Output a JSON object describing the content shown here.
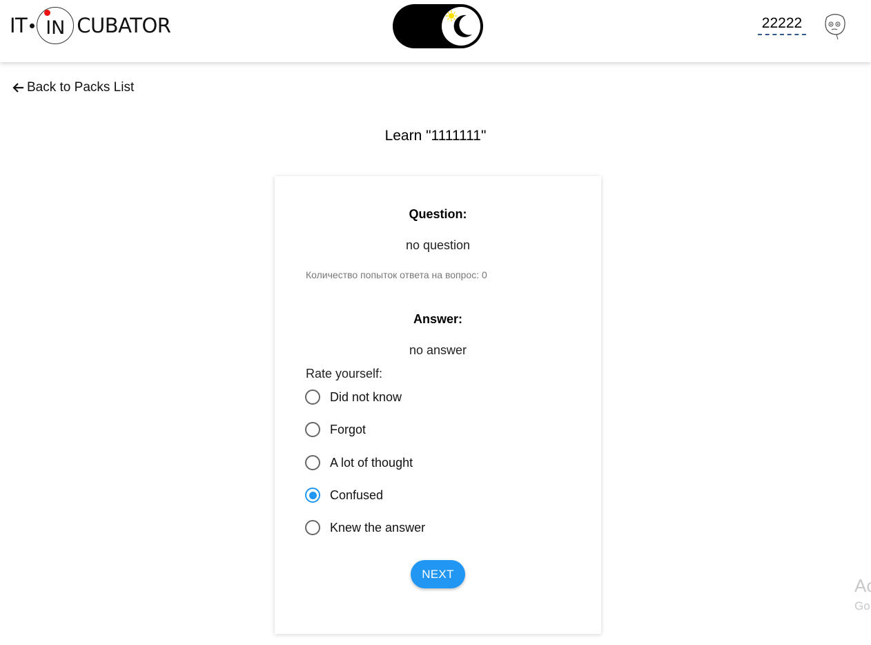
{
  "header": {
    "logo": {
      "left": "IT",
      "middle": "IN",
      "right": "CUBATOR"
    },
    "theme_toggle": {
      "state": "dark",
      "icon": "moon-sun-icon"
    },
    "user": {
      "name": "22222",
      "avatar_icon": "meme-face-avatar-icon"
    }
  },
  "nav": {
    "back_label": "Back to Packs List",
    "back_icon": "arrow-left-icon"
  },
  "page": {
    "title": "Learn \"1111111\""
  },
  "card": {
    "question_label": "Question:",
    "question_text": "no question",
    "attempts_text": "Количество попыток ответа на вопрос: 0",
    "answer_label": "Answer:",
    "answer_text": "no answer",
    "rate_label": "Rate yourself:",
    "options": [
      {
        "label": "Did not know",
        "selected": false
      },
      {
        "label": "Forgot",
        "selected": false
      },
      {
        "label": "A lot of thought",
        "selected": false
      },
      {
        "label": "Confused",
        "selected": true
      },
      {
        "label": "Knew the answer",
        "selected": false
      }
    ],
    "next_label": "NEXT"
  },
  "watermark": {
    "line1": "Ac",
    "line2": "Go"
  },
  "colors": {
    "accent": "#2196f3",
    "toggle_bg": "#000000",
    "sun": "#ffe000",
    "dashed_underline": "#2d5a8a"
  }
}
